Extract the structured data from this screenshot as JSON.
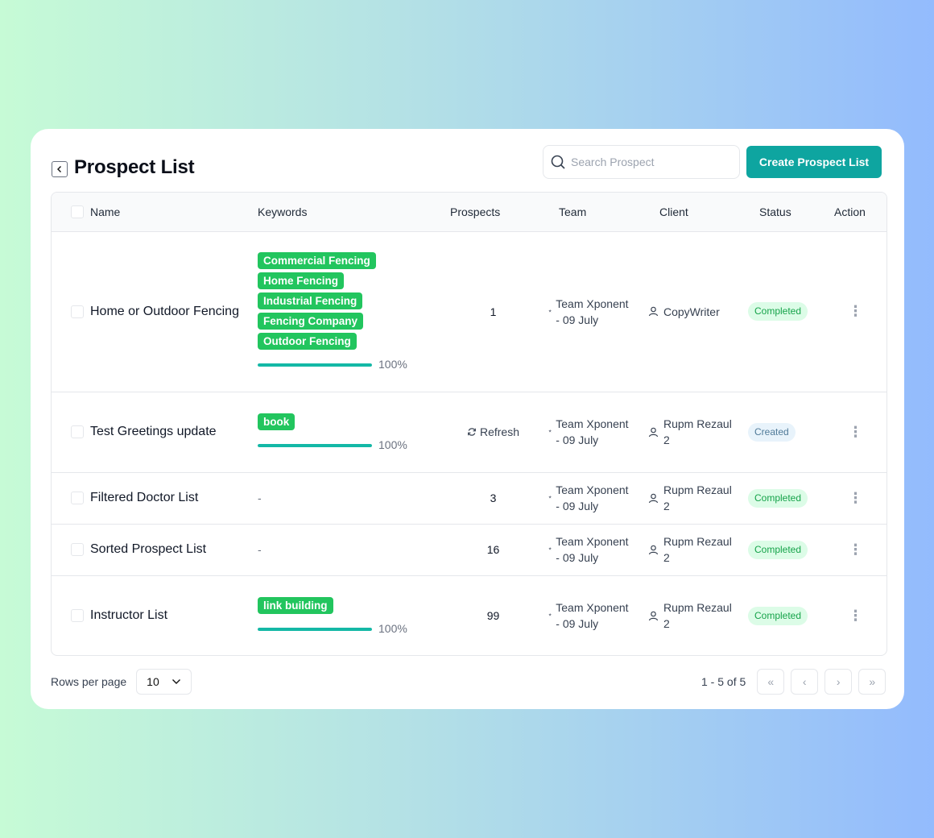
{
  "header": {
    "title": "Prospect List",
    "search_placeholder": "Search Prospect",
    "create_label": "Create Prospect List"
  },
  "table": {
    "columns": [
      "Name",
      "Keywords",
      "Prospects",
      "Team",
      "Client",
      "Status",
      "Action"
    ],
    "rows": [
      {
        "name": "Home or Outdoor Fencing",
        "keywords": [
          "Commercial Fencing",
          "Home Fencing",
          "Industrial Fencing",
          "Fencing Company",
          "Outdoor Fencing"
        ],
        "progress": "100%",
        "progress_value": 1.0,
        "prospects": "1",
        "team_line1": "Team Xponent",
        "team_line2": "- 09 July",
        "client_line1": "CopyWriter",
        "client_line2": "",
        "status": "Completed"
      },
      {
        "name": "Test Greetings update",
        "keywords": [
          "book"
        ],
        "progress": "100%",
        "progress_value": 1.0,
        "prospects": "Refresh",
        "team_line1": "Team Xponent",
        "team_line2": "- 09 July",
        "client_line1": "Rupm Rezaul",
        "client_line2": "2",
        "status": "Created"
      },
      {
        "name": "Filtered Doctor List",
        "keywords_text": "-",
        "prospects": "3",
        "team_line1": "Team Xponent",
        "team_line2": "- 09 July",
        "client_line1": "Rupm Rezaul",
        "client_line2": "2",
        "status": "Completed"
      },
      {
        "name": "Sorted Prospect List",
        "keywords_text": "-",
        "prospects": "16",
        "team_line1": "Team Xponent",
        "team_line2": "- 09 July",
        "client_line1": "Rupm Rezaul",
        "client_line2": "2",
        "status": "Completed"
      },
      {
        "name": "Instructor List",
        "keywords": [
          "link building"
        ],
        "progress": "100%",
        "progress_value": 1.0,
        "prospects": "99",
        "team_line1": "Team Xponent",
        "team_line2": "- 09 July",
        "client_line1": "Rupm Rezaul",
        "client_line2": "2",
        "status": "Completed"
      }
    ]
  },
  "footer": {
    "rows_label": "Rows per page",
    "rows_value": "10",
    "range": "1 - 5 of 5"
  },
  "icons": {
    "back": "chevron-left-icon",
    "search": "search-icon",
    "team": "users-icon",
    "client": "user-icon",
    "refresh": "refresh-icon",
    "action": "more-vertical-icon"
  },
  "colors": {
    "accent": "#0ea5a0",
    "tag": "#22c55e",
    "completed_bg": "#dcfce7",
    "completed_text": "#16a34a",
    "created_bg": "#e8f3fb",
    "created_text": "#507a98"
  }
}
